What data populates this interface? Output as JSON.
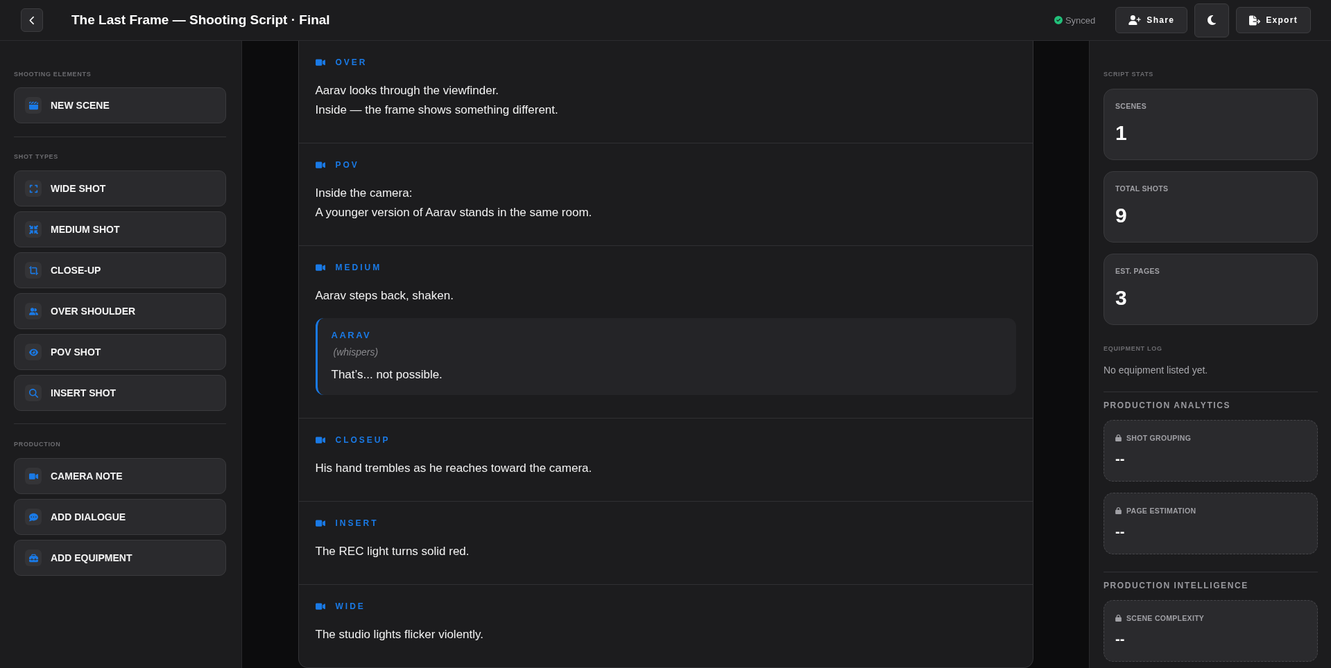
{
  "header": {
    "title": "The Last Frame — Shooting Script · Final",
    "sync": {
      "label": "Synced"
    },
    "buttons": [
      {
        "kind": "share",
        "label": "Share"
      },
      {
        "kind": "theme"
      },
      {
        "kind": "export",
        "label": "Export"
      }
    ]
  },
  "sidebar": {
    "sections": [
      {
        "title": "SHOOTING ELEMENTS",
        "items": [
          {
            "kind": "scene",
            "label": "NEW SCENE"
          }
        ]
      },
      {
        "title": "SHOT TYPES",
        "items": [
          {
            "kind": "wide",
            "label": "WIDE SHOT"
          },
          {
            "kind": "medium",
            "label": "MEDIUM SHOT"
          },
          {
            "kind": "closeup",
            "label": "CLOSE-UP"
          },
          {
            "kind": "shoulder",
            "label": "OVER SHOULDER"
          },
          {
            "kind": "pov",
            "label": "POV SHOT"
          },
          {
            "kind": "insert",
            "label": "INSERT SHOT"
          }
        ]
      },
      {
        "title": "PRODUCTION",
        "items": [
          {
            "kind": "camera",
            "label": "CAMERA NOTE"
          },
          {
            "kind": "dialogue",
            "label": "ADD DIALOGUE"
          },
          {
            "kind": "equipment",
            "label": "ADD EQUIPMENT"
          }
        ]
      }
    ]
  },
  "script": [
    {
      "shot": "OVER",
      "lines": [
        "Aarav looks through the viewfinder.",
        "Inside — the frame shows something different."
      ]
    },
    {
      "shot": "POV",
      "lines": [
        "Inside the camera:",
        "A younger version of Aarav stands in the same room."
      ]
    },
    {
      "shot": "MEDIUM",
      "lines": [
        "Aarav steps back, shaken."
      ],
      "dialogue": {
        "character": "AARAV",
        "parenthetical": "(whispers)",
        "line": "That’s... not possible."
      }
    },
    {
      "shot": "CLOSEUP",
      "lines": [
        "His hand trembles as he reaches toward the camera."
      ]
    },
    {
      "shot": "INSERT",
      "lines": [
        "The REC light turns solid red."
      ]
    },
    {
      "shot": "WIDE",
      "lines": [
        "The studio lights flicker violently."
      ]
    }
  ],
  "script_stats": {
    "title": "SCRIPT STATS",
    "cards": [
      {
        "label": "SCENES",
        "value": "1"
      },
      {
        "label": "TOTAL SHOTS",
        "value": "9"
      },
      {
        "label": "EST. PAGES",
        "value": "3"
      }
    ]
  },
  "equipment_log": {
    "title": "EQUIPMENT LOG",
    "empty_text": "No equipment listed yet."
  },
  "insight_groups": [
    {
      "title": "PRODUCTION ANALYTICS",
      "cards": [
        {
          "label": "SHOT GROUPING",
          "value": "--",
          "locked": true
        },
        {
          "label": "PAGE ESTIMATION",
          "value": "--",
          "locked": true
        }
      ]
    },
    {
      "title": "PRODUCTION INTELLIGENCE",
      "cards": [
        {
          "label": "SCENE COMPLEXITY",
          "value": "--",
          "locked": true
        }
      ]
    }
  ]
}
